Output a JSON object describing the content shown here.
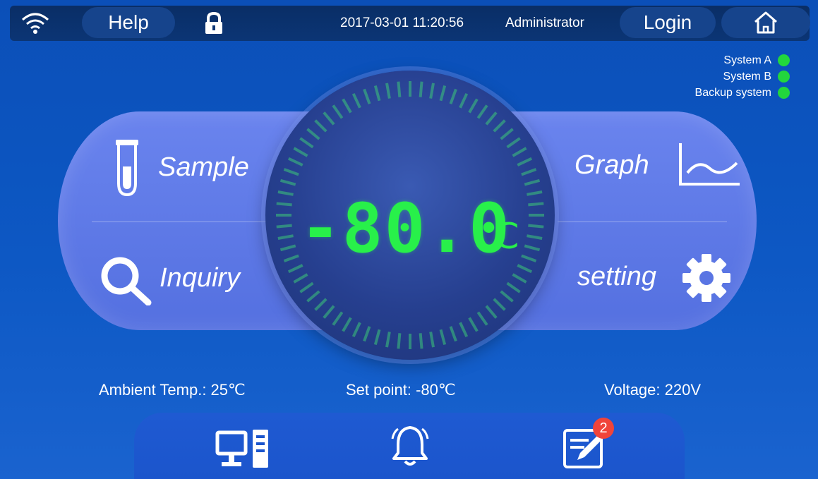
{
  "header": {
    "help_label": "Help",
    "datetime": "2017-03-01  11:20:56",
    "user": "Administrator",
    "login_label": "Login"
  },
  "status": [
    {
      "label": "System A",
      "color": "#22d63d"
    },
    {
      "label": "System B",
      "color": "#22d63d"
    },
    {
      "label": "Backup system",
      "color": "#22d63d"
    }
  ],
  "menu": {
    "sample": "Sample",
    "inquiry": "Inquiry",
    "graph": "Graph",
    "setting": "setting"
  },
  "temperature": {
    "value": "-80.0",
    "unit": "℃"
  },
  "info": {
    "ambient": "Ambient Temp.: 25℃",
    "setpoint": "Set point: -80℃",
    "voltage": "Voltage: 220V"
  },
  "notifications": {
    "badge": "2"
  },
  "icons": [
    "wifi-icon",
    "lock-icon",
    "home-icon",
    "test-tube-icon",
    "search-icon",
    "graph-icon",
    "gear-icon",
    "computer-icon",
    "bell-icon",
    "notes-icon"
  ]
}
